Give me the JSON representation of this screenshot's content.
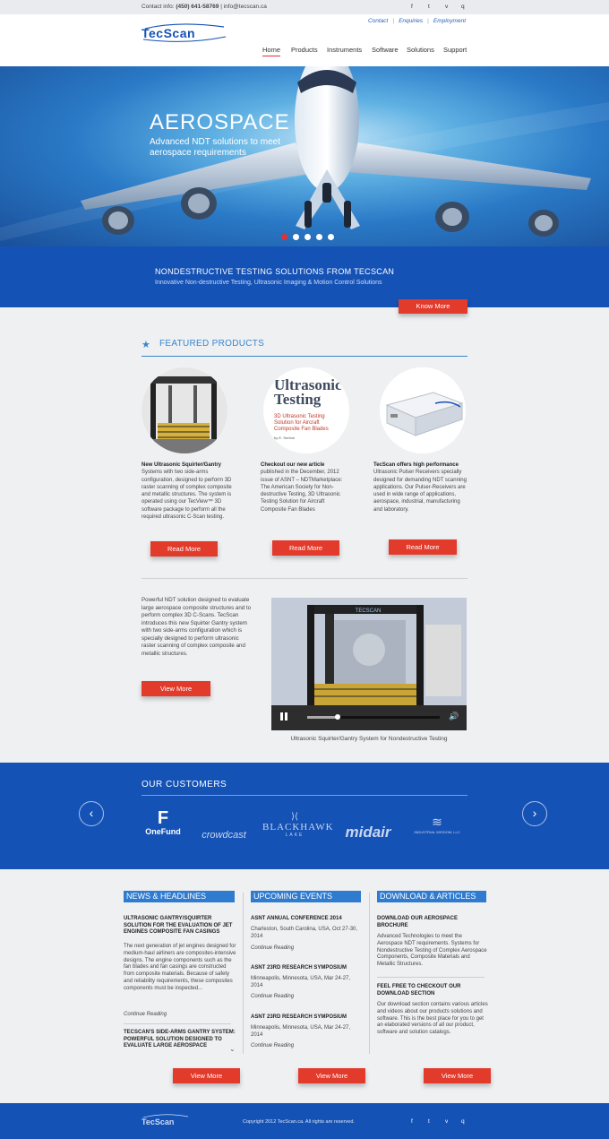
{
  "topbar": {
    "contact_label": "Contact info:",
    "phone": "(450) 641-58769",
    "email": "| info@tecscan.ca",
    "social": [
      "f",
      "t",
      "v",
      "q"
    ]
  },
  "header": {
    "logo_text": "TecScan",
    "top_links": [
      "Contact",
      "Enquiries",
      "Employment"
    ],
    "nav": [
      "Home",
      "Products",
      "Instruments",
      "Software",
      "Solutions",
      "Support"
    ]
  },
  "hero": {
    "title": "AEROSPACE",
    "subtitle": "Advanced NDT solutions to meet aerospace requirements",
    "slides": 5,
    "active_slide": 1
  },
  "strip": {
    "heading": "NONDESTRUCTIVE TESTING SOLUTIONS FROM TECSCAN",
    "subheading": "Innovative Non-destructive Testing, Ultrasonic Imaging & Motion Control Solutions",
    "button": "Know More"
  },
  "featured": {
    "heading": "FEATURED PRODUCTS",
    "products": [
      {
        "title": "New Ultrasonic Squirter/Gantry",
        "text": "Systems with two side-arms configuration, designed to perform 3D raster scanning of complex composite and metallic structures. The system is operated using our TecView™ 3D software package to perform all the required ultrasonic C-Scan testing.",
        "button": "Read More"
      },
      {
        "title": "Checkout our new article",
        "text": "published in the December, 2012 issue of ASNT – NDTMarketplace: The American Society for Non-destructive Testing, 3D Ultrasonic Testing Solution for Aircraft Composite Fan Blades",
        "button": "Read More"
      },
      {
        "title": "TecScan offers high performance",
        "text": "Ultrasonic Pulser Receivers specially designed for demanding NDT scanning applications. Our Pulser-Receivers are used in wide range of applications, aerospace, industrial, manufacturing and laboratory.",
        "button": "Read More"
      }
    ],
    "article_image": {
      "title": "Ultrasonic Testing",
      "subtitle": "3D Ultrasonic Testing Solution for Aircraft Composite Fan Blades",
      "byline": "by E. Serfoni"
    }
  },
  "video_section": {
    "text": "Powerful NDT solution designed to evaluate large aerospace composite structures and to perform complex 3D C-Scans. TecScan introduces this new Squirter Gantry system with two side-arms configuration which is specially designed to perform ultrasonic raster scanning of complex composite and metallic structures.",
    "button": "View More",
    "caption": "Ultrasonic Squirter/Gantry System for Nondestructive Testing",
    "video_label": "TECSCAN",
    "progress": 0.23
  },
  "customers": {
    "heading": "OUR CUSTOMERS",
    "logos": [
      "OneFund",
      "crowdcast",
      "BLACKHAWK",
      "LAKE",
      "midair",
      "INDUSTRIAL WISDOM, LLC"
    ]
  },
  "news": {
    "heading": "NEWS & HEADLINES",
    "items": [
      {
        "title": "ULTRASONIC GANTRY/SQUIRTER SOLUTION FOR THE EVALUATION OF JET ENGINES COMPOSITE FAN CASINGS",
        "text": "The next generation of jet engines designed for medium-haul airliners are composites-intensive designs. The engine components such as the fan blades and fan casings are constructed from composite materials. Because of safety and reliability requirements, these composites components must be inspected...",
        "link": "Continue Reading"
      },
      {
        "title": "TECSCAN'S SIDE-ARMS GANTRY SYSTEM: POWERFUL SOLUTION DESIGNED TO EVALUATE LARGE AEROSPACE"
      }
    ],
    "button": "View More"
  },
  "events": {
    "heading": "UPCOMING EVENTS",
    "items": [
      {
        "title": "ASNT ANNUAL CONFERENCE 2014",
        "text": "Charleston, South Carolina, USA, Oct 27-30, 2014",
        "link": "Continue Reading"
      },
      {
        "title": "ASNT 23RD RESEARCH SYMPOSIUM",
        "text": "Minneapolis, Minnesota, USA, Mar 24-27, 2014",
        "link": "Continue Reading"
      },
      {
        "title": "ASNT 23RD RESEARCH SYMPOSIUM",
        "text": "Minneapolis, Minnesota, USA, Mar 24-27, 2014",
        "link": "Continue Reading"
      }
    ],
    "button": "View More"
  },
  "downloads": {
    "heading": "DOWNLOAD & ARTICLES",
    "items": [
      {
        "title": "DOWNLOAD OUR AEROSPACE BROCHURE",
        "text": "Advanced Technologies to meet the Aerospace NDT requirements. Systems for Nondestructive Testing of Complex Aerospace Components, Composite Materials and Metallic Structures."
      },
      {
        "title": "FEEL FREE TO CHECKOUT OUR DOWNLOAD SECTION",
        "text": "Our download section contains various articles and videos about our products solutions and software. This is the best place for you to get an elaborated versions of all our product, software and solution catalogs."
      }
    ],
    "button": "View More"
  },
  "footer": {
    "logo_text": "TecScan",
    "copyright": "Copyright 2012 TecScan.ca. All rights are reserved.",
    "social": [
      "f",
      "t",
      "v",
      "q"
    ]
  },
  "colors": {
    "brand_blue": "#1552b5",
    "accent_red": "#e23a2b",
    "heading_blue": "#3a86cf"
  }
}
